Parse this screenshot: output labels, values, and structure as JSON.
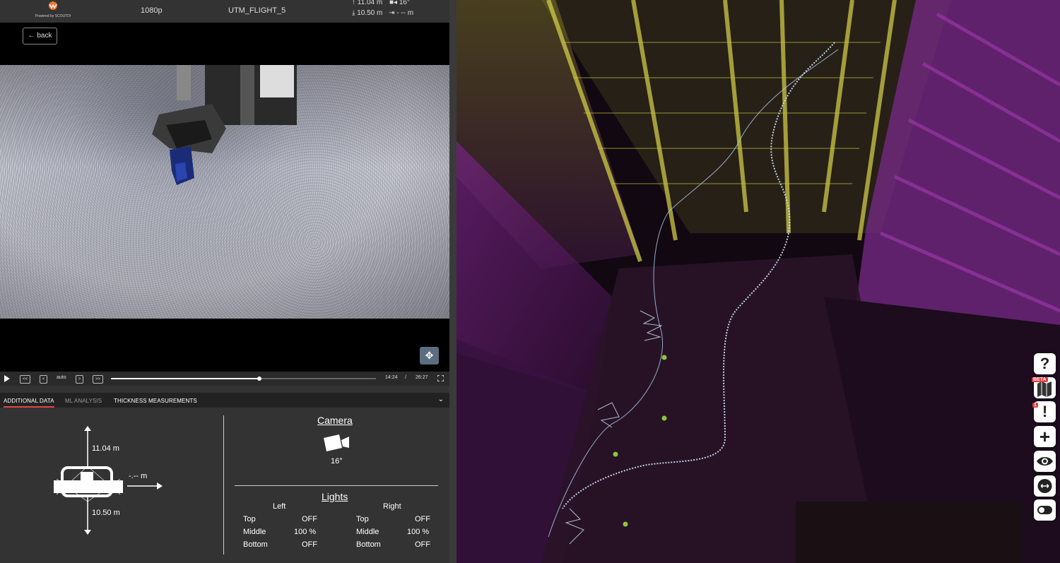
{
  "header": {
    "logo_text": "Powered by SCOUTDI",
    "resolution": "1080p",
    "flight_name": "UTM_FLIGHT_5",
    "altitude_up": "11.04 m",
    "camera_tilt": "16°",
    "altitude_down": "10.50 m",
    "range_side": "- -- m"
  },
  "back_label": "← back",
  "player": {
    "play_icon": "play-icon",
    "rewind_label": "<<",
    "step_back_label": "<",
    "speed_label": "auto",
    "step_fwd_label": ">",
    "ffwd_label": ">>",
    "current_time": "14:24",
    "separator": "/",
    "total_time": "26:27",
    "progress": 0.56
  },
  "tabs": [
    {
      "label": "ADDITIONAL DATA",
      "active": true
    },
    {
      "label": "ML ANALYSIS",
      "active": false
    },
    {
      "label": "THICKNESS MEASUREMENTS",
      "active": false
    }
  ],
  "drone": {
    "up_distance": "11.04 m",
    "down_distance": "10.50 m",
    "side_distance": "-.-- m"
  },
  "camera": {
    "title": "Camera",
    "angle": "16°"
  },
  "lights": {
    "title": "Lights",
    "left_label": "Left",
    "right_label": "Right",
    "rows": [
      {
        "name": "Top",
        "left": "OFF",
        "right": "OFF"
      },
      {
        "name": "Middle",
        "left": "100 %",
        "right": "100 %"
      },
      {
        "name": "Bottom",
        "left": "OFF",
        "right": "OFF"
      }
    ]
  },
  "right_toolbar": {
    "help": "?",
    "map_badge": "BETA",
    "alerts_badge": "1",
    "alerts": "!",
    "add": "+"
  }
}
